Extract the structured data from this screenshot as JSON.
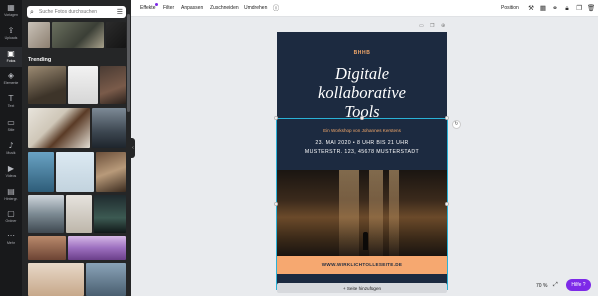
{
  "rail": {
    "items": [
      {
        "icon": "▦",
        "label": "Vorlagen"
      },
      {
        "icon": "⇪",
        "label": "Uploads"
      },
      {
        "icon": "▣",
        "label": "Fotos"
      },
      {
        "icon": "◈",
        "label": "Elemente"
      },
      {
        "icon": "T",
        "label": "Text"
      },
      {
        "icon": "▭",
        "label": "Stile"
      },
      {
        "icon": "♪",
        "label": "Musik"
      },
      {
        "icon": "▶",
        "label": "Videos"
      },
      {
        "icon": "▤",
        "label": "Hintergr."
      },
      {
        "icon": "▢",
        "label": "Ordner"
      },
      {
        "icon": "⋯",
        "label": "Mehr"
      }
    ]
  },
  "panel": {
    "search_placeholder": "Suche Fotos durchsuchen",
    "section_title": "Trending"
  },
  "toolbar": {
    "effects": "Effekte",
    "filter": "Filter",
    "adjust": "Anpassen",
    "crop": "Zuschneiden",
    "flip": "Umdrehen",
    "position": "Position"
  },
  "poster": {
    "brand": "BHHB",
    "title_line1": "Digitale",
    "title_line2": "kollaborative",
    "title_line3": "Tools",
    "subtitle": "Ein Workshop von Johannes Kerstens",
    "date": "23. MAI 2020 • 8 UHR BIS 21 UHR",
    "address": "MUSTERSTR. 123, 45678 MUSTERSTADT",
    "url": "WWW.WIRKLICHTOLLESEITE.DE"
  },
  "canvas": {
    "add_page": "+ Seite hinzufügen"
  },
  "footer": {
    "zoom": "70 %",
    "help": "Hilfe ?"
  },
  "colors": {
    "accent": "#7d2ae8",
    "poster_bg": "#1c2a40",
    "poster_orange": "#f6a870",
    "selection": "#2ab1d6"
  }
}
